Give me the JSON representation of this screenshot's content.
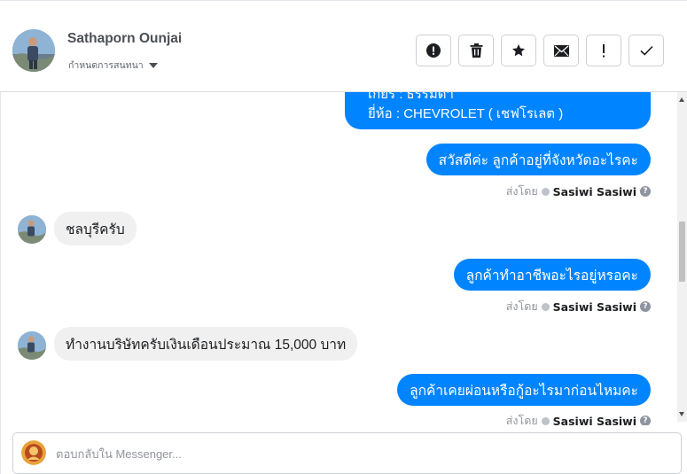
{
  "header": {
    "name": "Sathaporn Ounjai",
    "subtitle": "กำหนดการสนทนา",
    "actions": [
      {
        "icon": "alert-circle-icon",
        "name": "mark-spam-button"
      },
      {
        "icon": "trash-icon",
        "name": "delete-button"
      },
      {
        "icon": "star-icon",
        "name": "star-button"
      },
      {
        "icon": "envelope-icon",
        "name": "mark-unread-button"
      },
      {
        "icon": "exclamation-icon",
        "name": "follow-up-button"
      },
      {
        "icon": "checkmark-icon",
        "name": "mark-done-button"
      }
    ]
  },
  "messages": {
    "vehicle_line1": "เกียร์ : ธรรมดา",
    "vehicle_line2": "ยี่ห้อ : CHEVROLET ( เชฟโรเลต )",
    "out1": "สวัสดีค่ะ ลูกค้าอยู่ที่จังหวัดอะไรคะ",
    "in1": "ชลบุรีครับ",
    "out2": "ลูกค้าทำอาชีพอะไรอยู่หรอคะ",
    "in2": "ทำงานบริษัทครับเงินเดือนประมาณ 15,000 บาท",
    "out3": "ลูกค้าเคยผ่อนหรือกู้อะไรมาก่อนไหมคะ"
  },
  "sent_by": {
    "prefix": "ส่งโดย",
    "agent": "Sasiwi Sasiwi",
    "info": "?"
  },
  "composer": {
    "placeholder": "ตอบกลับใน Messenger..."
  },
  "colors": {
    "outgoing_bubble": "#0084ff",
    "incoming_bubble": "#f0f0f0"
  }
}
